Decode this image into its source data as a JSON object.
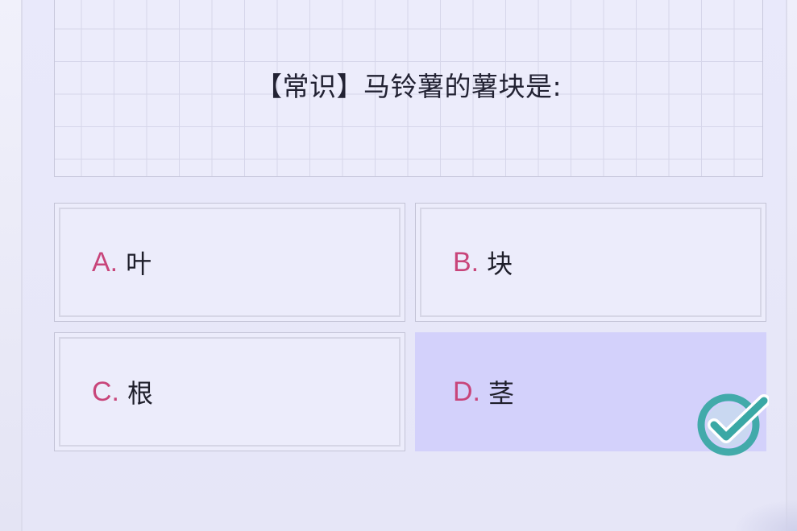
{
  "question": {
    "text": "【常识】马铃薯的薯块是:"
  },
  "options": [
    {
      "letter": "A.",
      "text": "叶"
    },
    {
      "letter": "B.",
      "text": "块"
    },
    {
      "letter": "C.",
      "text": "根"
    },
    {
      "letter": "D.",
      "text": "茎"
    }
  ],
  "selected_option": "D",
  "correct_indicator": {
    "icon": "check-circle-icon",
    "color": "#3aa8a5"
  },
  "colors": {
    "background": "#e9e9fb",
    "letter": "#c8457a",
    "selected": "#d3d1fb",
    "check": "#3aa8a5"
  }
}
